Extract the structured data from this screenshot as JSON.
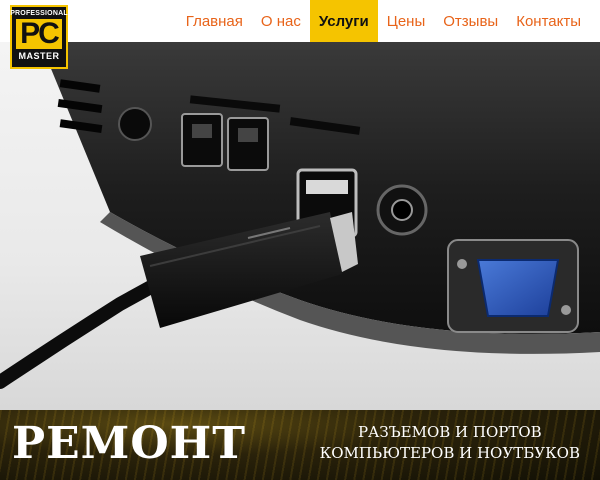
{
  "logo": {
    "top_text": "PROFESSIONAL",
    "main_text": "PC",
    "bottom_text": "MASTER"
  },
  "nav": {
    "items": [
      {
        "label": "Главная"
      },
      {
        "label": "О нас"
      },
      {
        "label": "Услуги"
      },
      {
        "label": "Цены"
      },
      {
        "label": "Отзывы"
      },
      {
        "label": "Контакты"
      }
    ],
    "active_index": 2
  },
  "banner": {
    "title": "РЕМОНТ",
    "subtitle_line1": "РАЗЪЕМОВ И ПОРТОВ",
    "subtitle_line2": "КОМПЬЮТЕРОВ И НОУТБУКОВ"
  },
  "colors": {
    "accent": "#f5c400",
    "nav_text": "#e8641a"
  }
}
